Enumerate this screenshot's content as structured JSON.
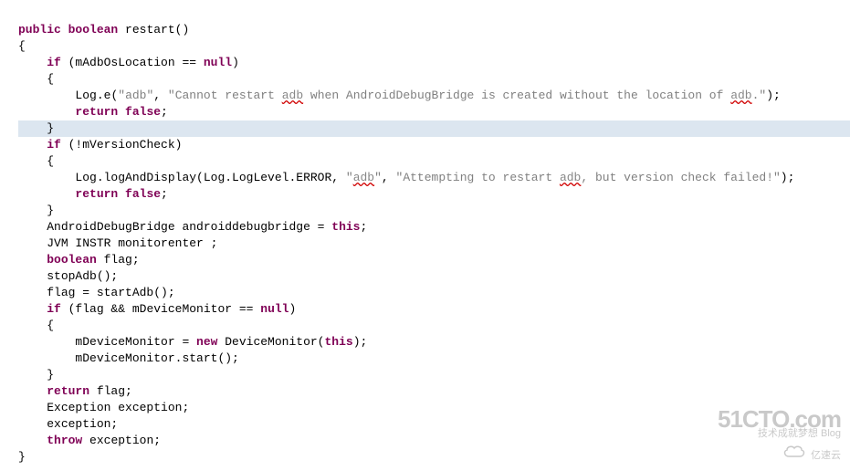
{
  "code": {
    "l1_public": "public",
    "l1_boolean": "boolean",
    "l1_name": " restart()",
    "l2": "{",
    "l3_if": "if",
    "l3_rest": " (mAdbOsLocation == ",
    "l3_null": "null",
    "l3_close": ")",
    "l4": "{",
    "l5_pre": "Log.",
    "l5_e": "e",
    "l5_open": "(",
    "l5_str1": "\"adb\"",
    "l5_comma": ", ",
    "l5_str2a": "\"Cannot restart ",
    "l5_adb": "adb",
    "l5_str2b": " when AndroidDebugBridge is created without the location of ",
    "l5_adb2": "adb",
    "l5_str2c": ".\"",
    "l5_close": ");",
    "l6_return": "return",
    "l6_false": " false",
    "l6_semi": ";",
    "l7": "}",
    "l8_if": "if",
    "l8_rest": " (!mVersionCheck)",
    "l9": "{",
    "l10_pre": "Log.logAndDisplay(Log.LogLevel.ERROR, ",
    "l10_str1": "\"",
    "l10_adb": "adb",
    "l10_str1b": "\"",
    "l10_comma": ", ",
    "l10_str2a": "\"Attempting to restart ",
    "l10_adb2": "adb",
    "l10_str2b": ", but version check failed!\"",
    "l10_close": ");",
    "l11_return": "return",
    "l11_false": " false",
    "l11_semi": ";",
    "l12": "}",
    "l13": "AndroidDebugBridge androiddebugbridge = ",
    "l13_this": "this",
    "l13_semi": ";",
    "l14": "JVM INSTR monitorenter ;",
    "l15_boolean": "boolean",
    "l15_rest": " flag;",
    "l16": "stopAdb();",
    "l17": "flag = startAdb();",
    "l18_if": "if",
    "l18_a": " (flag && mDeviceMonitor == ",
    "l18_null": "null",
    "l18_b": ")",
    "l19": "{",
    "l20a": "mDeviceMonitor = ",
    "l20_new": "new",
    "l20b": " DeviceMonitor(",
    "l20_this": "this",
    "l20c": ");",
    "l21": "mDeviceMonitor.start();",
    "l22": "}",
    "l23_return": "return",
    "l23_rest": " flag;",
    "l24": "Exception exception;",
    "l25": "exception;",
    "l26_throw": "throw",
    "l26_rest": " exception;",
    "l27": "}"
  },
  "watermark": {
    "big": "51CTO.com",
    "small": "技术成就梦想  Blog",
    "cloud_text": "亿速云"
  }
}
